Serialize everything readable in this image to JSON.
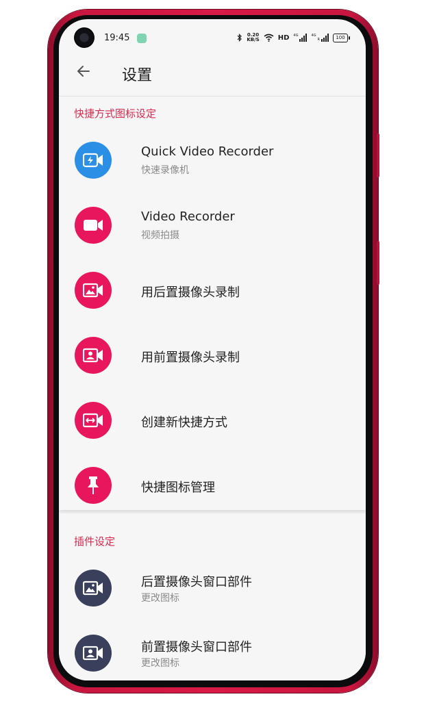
{
  "status_bar": {
    "time": "19:45",
    "net_speed_value": "0.20",
    "net_speed_unit": "KB/S",
    "hd_label": "HD",
    "network_label_1": "4G",
    "network_label_2": "4G",
    "network_sub_label": "R",
    "battery_level": "100"
  },
  "header": {
    "title": "设置"
  },
  "shortcut_section": {
    "title": "快捷方式图标设定",
    "items": [
      {
        "title": "Quick Video Recorder",
        "subtitle": "快速录像机",
        "icon": "flash-video-camera-icon",
        "color": "#2c8fe6"
      },
      {
        "title": "Video Recorder",
        "subtitle": "视频拍摄",
        "icon": "video-camera-icon",
        "color": "#e8175d"
      },
      {
        "title": "用后置摄像头录制",
        "icon": "rear-camera-record-icon",
        "color": "#e8175d"
      },
      {
        "title": "用前置摄像头录制",
        "icon": "front-camera-record-icon",
        "color": "#e8175d"
      },
      {
        "title": "创建新快捷方式",
        "icon": "create-shortcut-icon",
        "color": "#e8175d"
      },
      {
        "title": "快捷图标管理",
        "icon": "pin-icon",
        "color": "#e8175d"
      }
    ]
  },
  "widget_section": {
    "title": "插件设定",
    "items": [
      {
        "title": "后置摄像头窗口部件",
        "subtitle": "更改图标",
        "icon": "rear-camera-widget-icon",
        "color": "#3a3f5c"
      },
      {
        "title": "前置摄像头窗口部件",
        "subtitle": "更改图标",
        "icon": "front-camera-widget-icon",
        "color": "#3a3f5c"
      }
    ]
  },
  "colors": {
    "accent": "#d9294f",
    "phone_frame": "#d81b46",
    "screen_bg": "#f6f6f6",
    "primary_text": "#222222",
    "secondary_text": "#8a8a8a"
  }
}
